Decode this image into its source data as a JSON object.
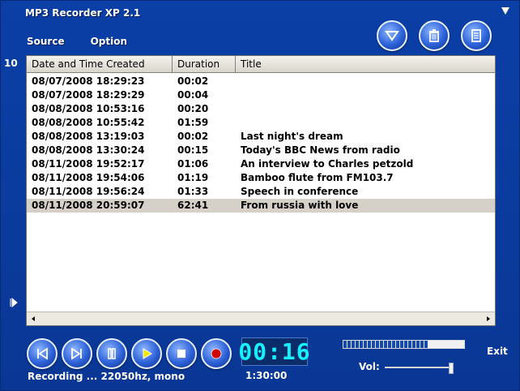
{
  "window": {
    "title": "MP3 Recorder XP 2.1"
  },
  "menu": {
    "items": [
      {
        "label": "Source"
      },
      {
        "label": "Option"
      }
    ]
  },
  "toolbar": {
    "icons": [
      "dropdown-arrow-icon",
      "trash-icon",
      "notes-icon"
    ]
  },
  "list": {
    "count_label": "10",
    "columns": [
      "Date and Time Created",
      "Duration",
      "Title"
    ],
    "rows": [
      {
        "date_time": "08/07/2008 18:29:23",
        "duration": "00:02",
        "title": ""
      },
      {
        "date_time": "08/07/2008 18:29:29",
        "duration": "00:04",
        "title": ""
      },
      {
        "date_time": "08/08/2008 10:53:16",
        "duration": "00:20",
        "title": ""
      },
      {
        "date_time": "08/08/2008 10:55:42",
        "duration": "01:59",
        "title": ""
      },
      {
        "date_time": "08/08/2008 13:19:03",
        "duration": "00:02",
        "title": "Last night's dream"
      },
      {
        "date_time": "08/08/2008 13:30:24",
        "duration": "00:15",
        "title": "Today's BBC News from radio"
      },
      {
        "date_time": "08/11/2008 19:52:17",
        "duration": "01:06",
        "title": "An interview to Charles petzold"
      },
      {
        "date_time": "08/11/2008 19:54:06",
        "duration": "01:19",
        "title": "Bamboo flute from FM103.7"
      },
      {
        "date_time": "08/11/2008 19:56:24",
        "duration": "01:33",
        "title": "Speech in conference"
      },
      {
        "date_time": "08/11/2008 20:59:07",
        "duration": "62:41",
        "title": "From russia with love"
      }
    ],
    "selected_row": 9
  },
  "playback": {
    "status": "Recording ... 22050hz, mono",
    "timer": "00:16",
    "total": "1:30:00",
    "level_fraction": 0.7,
    "volume_fraction": 0.95,
    "exit_label": "Exit"
  },
  "colors": {
    "accent": "#17f0ff",
    "background": "#0a3a9c",
    "selected": "#d5d0c8"
  }
}
